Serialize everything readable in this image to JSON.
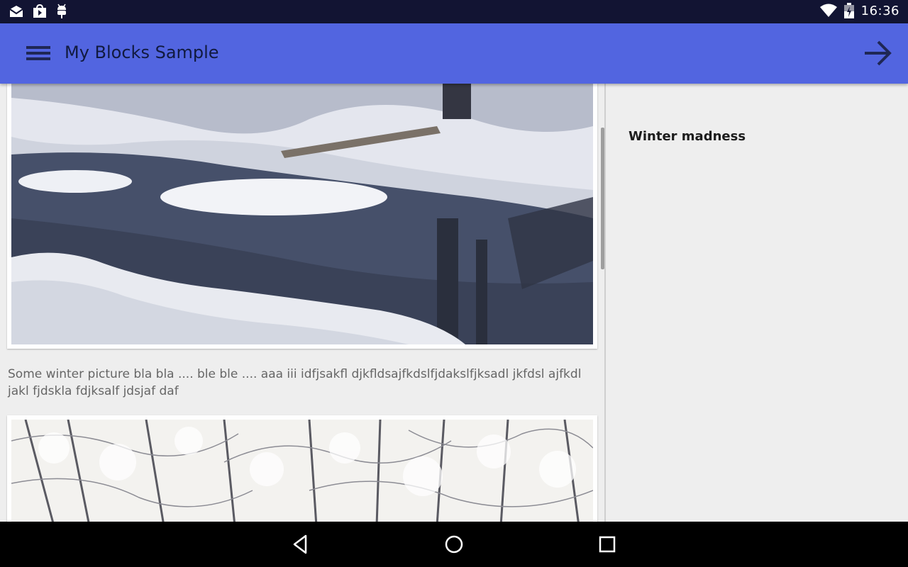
{
  "status_bar": {
    "time": "16:36",
    "left_icons": [
      "mail-icon",
      "store-bag-icon",
      "android-debug-icon"
    ],
    "right_icons": [
      "wifi-icon",
      "battery-charging-icon"
    ]
  },
  "app_bar": {
    "title": "My Blocks Sample",
    "menu_icon": "hamburger-menu-icon",
    "action_icon": "arrow-forward-icon",
    "background": "#5265e0"
  },
  "list": {
    "items": [
      {
        "image": "frozen-river-landscape",
        "caption": "Some winter picture bla bla .... ble ble .... aaa iii idfjsakfl djkfldsajfkdslfjdakslfjksadl jkfdsl ajfkdl jakl fjdskla fdjksalf jdsjaf daf"
      },
      {
        "image": "snowy-forest-trees",
        "caption": ""
      }
    ]
  },
  "detail": {
    "title": "Winter madness"
  },
  "nav_bar": {
    "buttons": [
      "back-icon",
      "home-icon",
      "recents-icon"
    ]
  }
}
